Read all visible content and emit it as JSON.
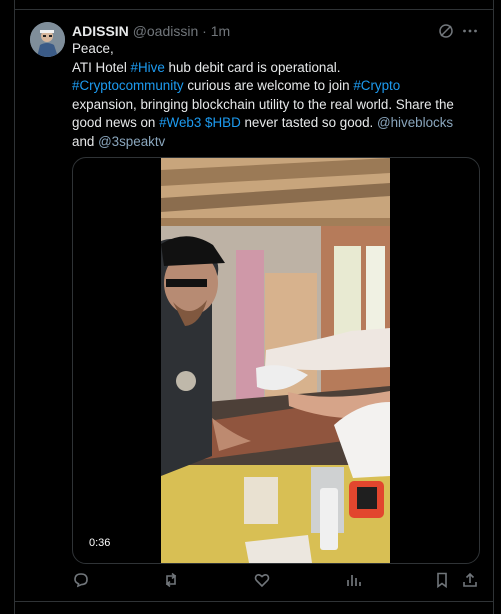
{
  "tweet": {
    "author_name": "ADISSIN",
    "handle": "@oadissin",
    "separator": "·",
    "time": "1m",
    "line1": "Peace,",
    "line2_prefix": "ATI Hotel ",
    "hashtag_hive": "#Hive",
    "line2_suffix": " hub debit card is operational.",
    "hashtag_cryptocommunity": "#Cryptocommunity",
    "line3_mid": " curious are welcome  to join  ",
    "hashtag_crypto": "#Crypto",
    "line4": "expansion, bringing blockchain utility to the real world. Share the",
    "line5_prefix": "good news on ",
    "hashtag_web3": "#Web3",
    "space": " ",
    "cashtag_hbd": "$HBD",
    "line5_mid": " never tasted so good. ",
    "mention_hiveblocks": "@hiveblocks",
    "line6_prefix": "and ",
    "mention_3speaktv": "@3speaktv"
  },
  "media": {
    "duration": "0:36"
  },
  "actions": {
    "icons": [
      "reply-icon",
      "repost-icon",
      "like-icon",
      "views-icon",
      "bookmark-icon",
      "share-icon"
    ]
  },
  "colors": {
    "background": "#000000",
    "text": "#e7e9ea",
    "muted": "#71767b",
    "link": "#1d9bf0",
    "border": "#2f3336"
  }
}
